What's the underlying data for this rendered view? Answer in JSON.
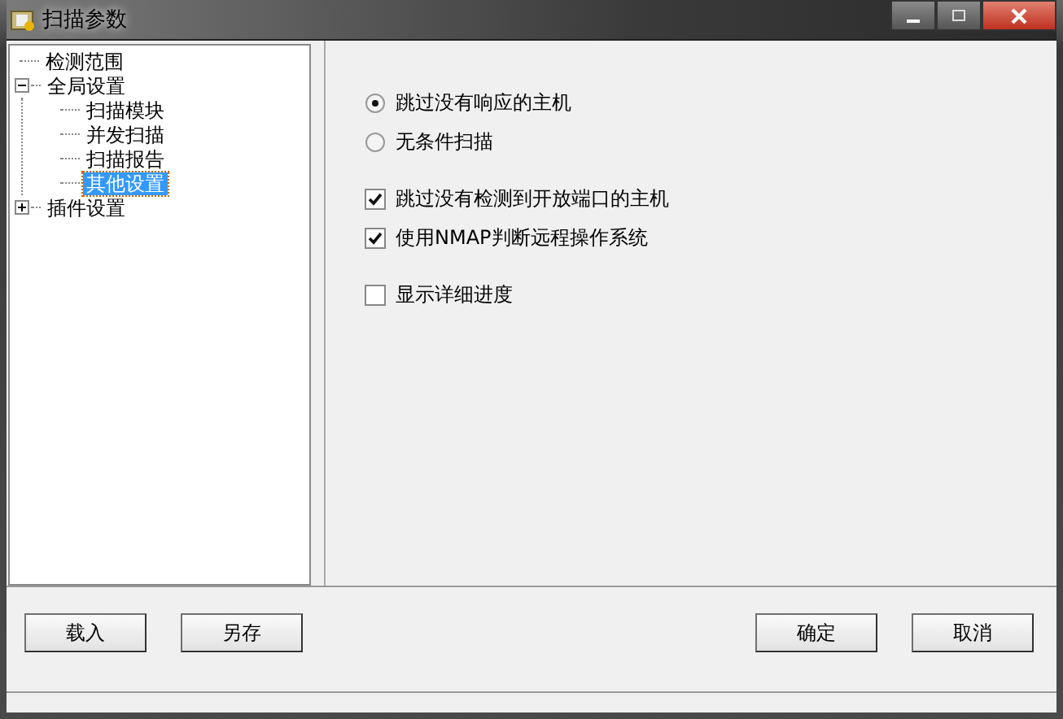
{
  "window": {
    "title": "扫描参数"
  },
  "tree": [
    {
      "label": "检测范围",
      "selected": false
    },
    {
      "label": "全局设置",
      "selected": false,
      "expanded": true,
      "children": [
        {
          "label": "扫描模块",
          "selected": false
        },
        {
          "label": "并发扫描",
          "selected": false
        },
        {
          "label": "扫描报告",
          "selected": false
        },
        {
          "label": "其他设置",
          "selected": true
        }
      ]
    },
    {
      "label": "插件设置",
      "selected": false,
      "expanded": false
    }
  ],
  "option_groups": [
    [
      {
        "kind": "radio",
        "label": "跳过没有响应的主机",
        "selected": true
      },
      {
        "kind": "radio",
        "label": "无条件扫描",
        "selected": false
      }
    ],
    [
      {
        "kind": "checkbox",
        "label": "跳过没有检测到开放端口的主机",
        "checked": true
      },
      {
        "kind": "checkbox",
        "label": "使用NMAP判断远程操作系统",
        "checked": true
      }
    ],
    [
      {
        "kind": "checkbox",
        "label": "显示详细进度",
        "checked": false
      }
    ]
  ],
  "left_buttons": [
    "载入",
    "另存"
  ],
  "right_buttons": [
    "确定",
    "取消"
  ]
}
